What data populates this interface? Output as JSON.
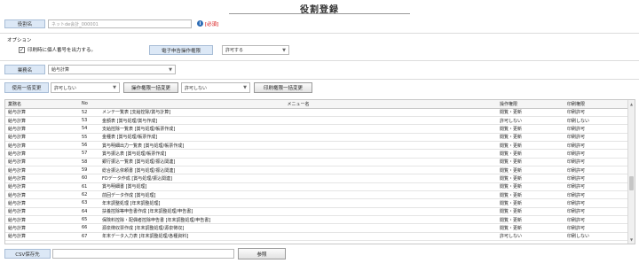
{
  "page": {
    "title": "役割登録"
  },
  "role_name": {
    "label": "役割名",
    "placeholder": "ネットde会計_000001",
    "required_text": "[必須]"
  },
  "options": {
    "label": "オプション",
    "print_personal_number": {
      "label": "印刷時に個人番号を出力する。",
      "checked": true
    }
  },
  "e_filing": {
    "label": "電子申告操作権限",
    "value": "許可する"
  },
  "system_name": {
    "label": "業務名",
    "value": "給与計算"
  },
  "bulk": {
    "usage_label": "使用一括変更",
    "usage_value": "許可しない",
    "operation_label": "操作権限一括変更",
    "operation_value": "許可しない",
    "print_button": "印刷権限一括変更"
  },
  "table": {
    "headers": [
      "業務名",
      "No",
      "メニュー名",
      "操作権限",
      "印刷権限"
    ],
    "rows": [
      [
        "給与計算",
        "52",
        "メンテ一覧表 [支給控除/賞与計算]",
        "閲覧・更新",
        "印刷許可"
      ],
      [
        "給与計算",
        "53",
        "金額表 [賞与処理/賞与作成]",
        "許可しない",
        "印刷しない"
      ],
      [
        "給与計算",
        "54",
        "支給控除一覧表 [賞与処理/帳票作成]",
        "閲覧・更新",
        "印刷許可"
      ],
      [
        "給与計算",
        "55",
        "金種表 [賞与処理/帳票作成]",
        "閲覧・更新",
        "印刷許可"
      ],
      [
        "給与計算",
        "56",
        "賞与明細出力一覧表 [賞与処理/帳票作成]",
        "閲覧・更新",
        "印刷許可"
      ],
      [
        "給与計算",
        "57",
        "賞与振込表 [賞与処理/帳票作成]",
        "閲覧・更新",
        "印刷許可"
      ],
      [
        "給与計算",
        "58",
        "銀行振込一覧表 [賞与処理/振込関連]",
        "閲覧・更新",
        "印刷許可"
      ],
      [
        "給与計算",
        "59",
        "総合振込依頼書 [賞与処理/振込関連]",
        "閲覧・更新",
        "印刷許可"
      ],
      [
        "給与計算",
        "60",
        "FDデータ作成 [賞与処理/振込関連]",
        "閲覧・更新",
        "印刷許可"
      ],
      [
        "給与計算",
        "61",
        "賞与明細書 [賞与処理]",
        "閲覧・更新",
        "印刷許可"
      ],
      [
        "給与計算",
        "62",
        "前回データ作成 [賞与処理]",
        "閲覧・更新",
        "印刷許可"
      ],
      [
        "給与計算",
        "63",
        "年末調整処理 [年末調整処理]",
        "閲覧・更新",
        "印刷許可"
      ],
      [
        "給与計算",
        "64",
        "扶養控除等申告書作成 [年末調整処理/申告書]",
        "閲覧・更新",
        "印刷許可"
      ],
      [
        "給与計算",
        "65",
        "保険料控除・配偶者控除申告書 [年末調整処理/申告書]",
        "閲覧・更新",
        "印刷許可"
      ],
      [
        "給与計算",
        "66",
        "源泉徴収票作成 [年末調整処理/源泉徴収]",
        "閲覧・更新",
        "印刷許可"
      ],
      [
        "給与計算",
        "67",
        "年末データ入力表 [年末調整処理/各種資料]",
        "許可しない",
        "印刷しない"
      ]
    ]
  },
  "csv": {
    "label": "CSV保存先",
    "value": "",
    "browse_button": "参照"
  }
}
